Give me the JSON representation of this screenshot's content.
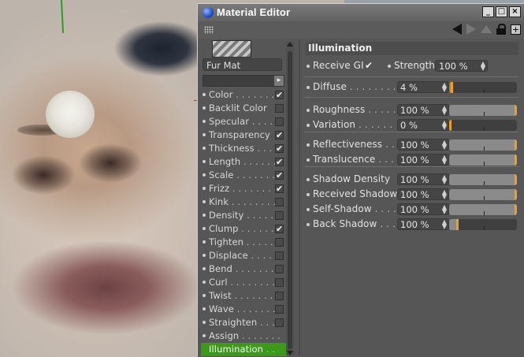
{
  "window": {
    "title": "Material Editor",
    "controls": [
      "_",
      "□",
      "×"
    ]
  },
  "toolbar": {
    "icons": [
      "grip-icon",
      "arrow-left-icon",
      "arrow-right-icon",
      "arrow-up-icon",
      "lock-icon",
      "new-window-icon"
    ]
  },
  "material": {
    "name": "Fur Mat"
  },
  "channels": [
    {
      "label": "Color",
      "leader": " . . . . . . . .",
      "checked": true
    },
    {
      "label": "Backlit Color",
      "leader": "",
      "checked": false
    },
    {
      "label": "Specular",
      "leader": " . . . . .",
      "checked": false
    },
    {
      "label": "Transparency",
      "leader": "",
      "checked": true
    },
    {
      "label": "Thickness",
      "leader": " . . . .",
      "checked": true
    },
    {
      "label": "Length",
      "leader": " . . . . . . .",
      "checked": true
    },
    {
      "label": "Scale",
      "leader": " . . . . . . . .",
      "checked": true
    },
    {
      "label": "Frizz",
      "leader": " . . . . . . . .",
      "checked": true
    },
    {
      "label": "Kink",
      "leader": " . . . . . . . . .",
      "checked": false
    },
    {
      "label": "Density",
      "leader": " . . . . . .",
      "checked": false
    },
    {
      "label": "Clump",
      "leader": " . . . . . . .",
      "checked": true
    },
    {
      "label": "Tighten",
      "leader": " . . . . . .",
      "checked": false
    },
    {
      "label": "Displace",
      "leader": " . . . . .",
      "checked": false
    },
    {
      "label": "Bend",
      "leader": " . . . . . . . .",
      "checked": false
    },
    {
      "label": "Curl",
      "leader": " . . . . . . . . .",
      "checked": false
    },
    {
      "label": "Twist",
      "leader": " . . . . . . . .",
      "checked": false
    },
    {
      "label": "Wave",
      "leader": " . . . . . . . .",
      "checked": false
    },
    {
      "label": "Straighten",
      "leader": " . . .",
      "checked": false
    },
    {
      "label": "Assign",
      "leader": " . . . . . . .",
      "checked": null
    },
    {
      "label": "Illumination",
      "leader": " . .",
      "checked": null,
      "active": true
    }
  ],
  "illumination": {
    "section_title": "Illumination",
    "receive_gi": {
      "label": "Receive GI",
      "checked": true
    },
    "strength": {
      "label": "Strength",
      "value": "100 %"
    },
    "params": [
      {
        "label": "Diffuse",
        "leader": " . . . . . . . . . .",
        "value": "4 %",
        "level": 0.04
      },
      {
        "label": "Roughness",
        "leader": " . . . . .",
        "value": "100 %",
        "level": 1.0
      },
      {
        "label": "Variation",
        "leader": " . . . . . .",
        "value": "0 %",
        "level": 0.0
      },
      {
        "label": "Reflectiveness",
        "leader": " . .",
        "value": "100 %",
        "level": 1.0
      },
      {
        "label": "Translucence",
        "leader": " . . .",
        "value": "100 %",
        "level": 1.0
      },
      {
        "label": "Shadow Density",
        "leader": "",
        "value": "100 %",
        "level": 1.0
      },
      {
        "label": "Received Shadow",
        "leader": "",
        "value": "100 %",
        "level": 1.0
      },
      {
        "label": "Self-Shadow",
        "leader": " . . . .",
        "value": "100 %",
        "level": 1.0
      },
      {
        "label": "Back Shadow",
        "leader": " . . . .",
        "value": "100 %",
        "level": 0.12
      }
    ]
  },
  "colors": {
    "panel_bg": "#565656",
    "active_channel": "#3c9a1a",
    "slider_knob": "#f0a020"
  }
}
